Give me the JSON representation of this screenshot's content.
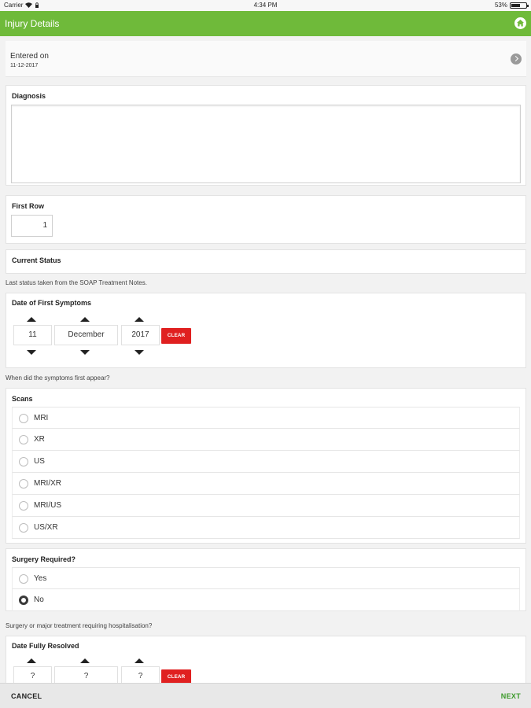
{
  "status_bar": {
    "carrier": "Carrier",
    "time": "4:34 PM",
    "battery": "53%"
  },
  "navbar": {
    "title": "Injury Details",
    "home_icon": "home-icon"
  },
  "entered": {
    "label": "Entered on",
    "date": "11-12-2017"
  },
  "diagnosis": {
    "label": "Diagnosis",
    "value": ""
  },
  "first_row": {
    "label": "First Row",
    "value": "1"
  },
  "current_status": {
    "label": "Current Status",
    "helper": "Last status taken from the SOAP Treatment Notes."
  },
  "date_first_symptoms": {
    "label": "Date of First Symptoms",
    "day": "11",
    "month": "December",
    "year": "2017",
    "clear_label": "CLEAR",
    "helper": "When did the symptoms first appear?"
  },
  "scans": {
    "label": "Scans",
    "options": [
      "MRI",
      "XR",
      "US",
      "MRI/XR",
      "MRI/US",
      "US/XR"
    ]
  },
  "surgery": {
    "label": "Surgery Required?",
    "options": [
      "Yes",
      "No"
    ],
    "selected": "No",
    "helper": "Surgery or major treatment requiring hospitalisation?"
  },
  "date_resolved": {
    "label": "Date Fully Resolved",
    "day": "?",
    "month": "?",
    "year": "?",
    "clear_label": "CLEAR"
  },
  "bottom": {
    "cancel": "CANCEL",
    "next": "NEXT"
  },
  "colors": {
    "accent": "#6fba3a",
    "clear": "#e02020",
    "next": "#3c9a2a"
  }
}
